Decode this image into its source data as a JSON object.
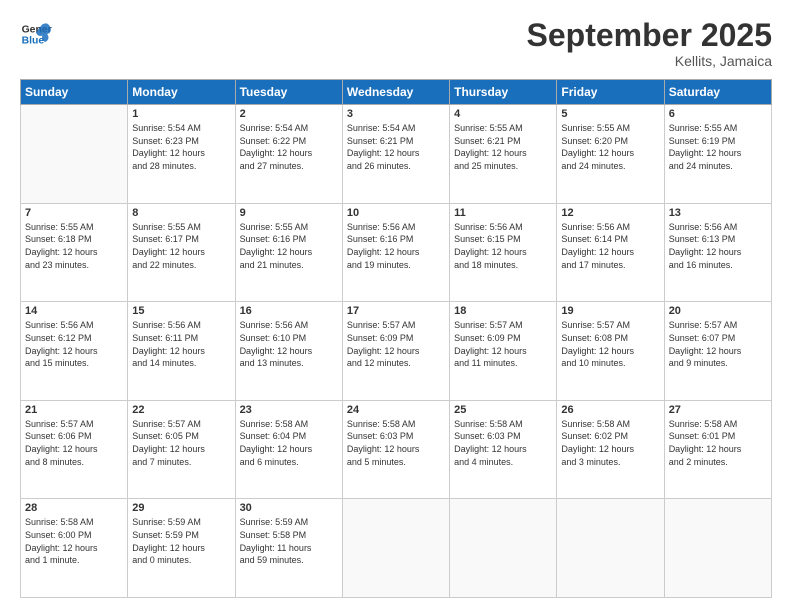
{
  "header": {
    "logo_line1": "General",
    "logo_line2": "Blue",
    "month": "September 2025",
    "location": "Kellits, Jamaica"
  },
  "weekdays": [
    "Sunday",
    "Monday",
    "Tuesday",
    "Wednesday",
    "Thursday",
    "Friday",
    "Saturday"
  ],
  "weeks": [
    [
      {
        "day": "",
        "info": ""
      },
      {
        "day": "1",
        "info": "Sunrise: 5:54 AM\nSunset: 6:23 PM\nDaylight: 12 hours\nand 28 minutes."
      },
      {
        "day": "2",
        "info": "Sunrise: 5:54 AM\nSunset: 6:22 PM\nDaylight: 12 hours\nand 27 minutes."
      },
      {
        "day": "3",
        "info": "Sunrise: 5:54 AM\nSunset: 6:21 PM\nDaylight: 12 hours\nand 26 minutes."
      },
      {
        "day": "4",
        "info": "Sunrise: 5:55 AM\nSunset: 6:21 PM\nDaylight: 12 hours\nand 25 minutes."
      },
      {
        "day": "5",
        "info": "Sunrise: 5:55 AM\nSunset: 6:20 PM\nDaylight: 12 hours\nand 24 minutes."
      },
      {
        "day": "6",
        "info": "Sunrise: 5:55 AM\nSunset: 6:19 PM\nDaylight: 12 hours\nand 24 minutes."
      }
    ],
    [
      {
        "day": "7",
        "info": "Sunrise: 5:55 AM\nSunset: 6:18 PM\nDaylight: 12 hours\nand 23 minutes."
      },
      {
        "day": "8",
        "info": "Sunrise: 5:55 AM\nSunset: 6:17 PM\nDaylight: 12 hours\nand 22 minutes."
      },
      {
        "day": "9",
        "info": "Sunrise: 5:55 AM\nSunset: 6:16 PM\nDaylight: 12 hours\nand 21 minutes."
      },
      {
        "day": "10",
        "info": "Sunrise: 5:56 AM\nSunset: 6:16 PM\nDaylight: 12 hours\nand 19 minutes."
      },
      {
        "day": "11",
        "info": "Sunrise: 5:56 AM\nSunset: 6:15 PM\nDaylight: 12 hours\nand 18 minutes."
      },
      {
        "day": "12",
        "info": "Sunrise: 5:56 AM\nSunset: 6:14 PM\nDaylight: 12 hours\nand 17 minutes."
      },
      {
        "day": "13",
        "info": "Sunrise: 5:56 AM\nSunset: 6:13 PM\nDaylight: 12 hours\nand 16 minutes."
      }
    ],
    [
      {
        "day": "14",
        "info": "Sunrise: 5:56 AM\nSunset: 6:12 PM\nDaylight: 12 hours\nand 15 minutes."
      },
      {
        "day": "15",
        "info": "Sunrise: 5:56 AM\nSunset: 6:11 PM\nDaylight: 12 hours\nand 14 minutes."
      },
      {
        "day": "16",
        "info": "Sunrise: 5:56 AM\nSunset: 6:10 PM\nDaylight: 12 hours\nand 13 minutes."
      },
      {
        "day": "17",
        "info": "Sunrise: 5:57 AM\nSunset: 6:09 PM\nDaylight: 12 hours\nand 12 minutes."
      },
      {
        "day": "18",
        "info": "Sunrise: 5:57 AM\nSunset: 6:09 PM\nDaylight: 12 hours\nand 11 minutes."
      },
      {
        "day": "19",
        "info": "Sunrise: 5:57 AM\nSunset: 6:08 PM\nDaylight: 12 hours\nand 10 minutes."
      },
      {
        "day": "20",
        "info": "Sunrise: 5:57 AM\nSunset: 6:07 PM\nDaylight: 12 hours\nand 9 minutes."
      }
    ],
    [
      {
        "day": "21",
        "info": "Sunrise: 5:57 AM\nSunset: 6:06 PM\nDaylight: 12 hours\nand 8 minutes."
      },
      {
        "day": "22",
        "info": "Sunrise: 5:57 AM\nSunset: 6:05 PM\nDaylight: 12 hours\nand 7 minutes."
      },
      {
        "day": "23",
        "info": "Sunrise: 5:58 AM\nSunset: 6:04 PM\nDaylight: 12 hours\nand 6 minutes."
      },
      {
        "day": "24",
        "info": "Sunrise: 5:58 AM\nSunset: 6:03 PM\nDaylight: 12 hours\nand 5 minutes."
      },
      {
        "day": "25",
        "info": "Sunrise: 5:58 AM\nSunset: 6:03 PM\nDaylight: 12 hours\nand 4 minutes."
      },
      {
        "day": "26",
        "info": "Sunrise: 5:58 AM\nSunset: 6:02 PM\nDaylight: 12 hours\nand 3 minutes."
      },
      {
        "day": "27",
        "info": "Sunrise: 5:58 AM\nSunset: 6:01 PM\nDaylight: 12 hours\nand 2 minutes."
      }
    ],
    [
      {
        "day": "28",
        "info": "Sunrise: 5:58 AM\nSunset: 6:00 PM\nDaylight: 12 hours\nand 1 minute."
      },
      {
        "day": "29",
        "info": "Sunrise: 5:59 AM\nSunset: 5:59 PM\nDaylight: 12 hours\nand 0 minutes."
      },
      {
        "day": "30",
        "info": "Sunrise: 5:59 AM\nSunset: 5:58 PM\nDaylight: 11 hours\nand 59 minutes."
      },
      {
        "day": "",
        "info": ""
      },
      {
        "day": "",
        "info": ""
      },
      {
        "day": "",
        "info": ""
      },
      {
        "day": "",
        "info": ""
      }
    ]
  ]
}
